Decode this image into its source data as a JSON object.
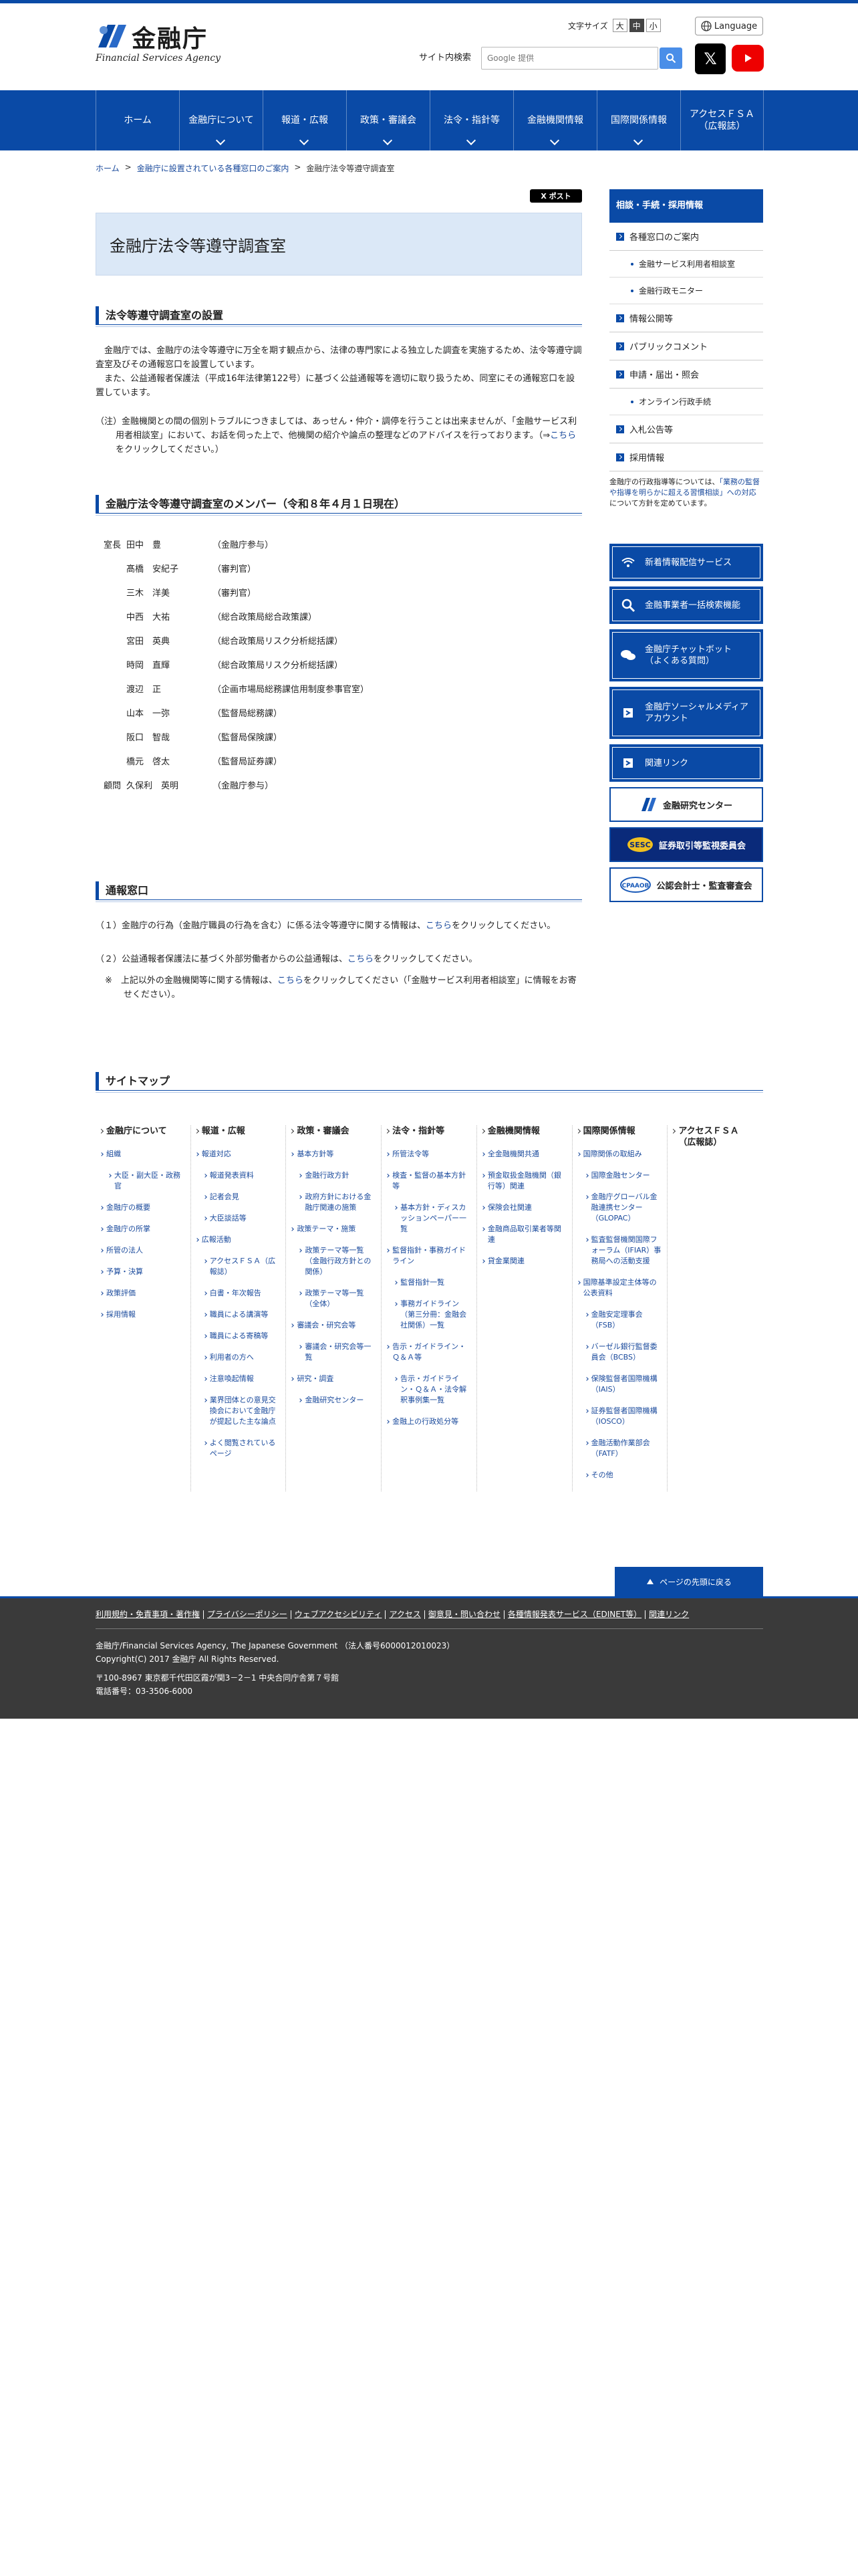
{
  "header": {
    "logo_ja": "金融庁",
    "logo_en": "Financial Services Agency",
    "fontsize_label": "文字サイズ",
    "fontsizes": [
      "大",
      "中",
      "小"
    ],
    "language_label": "Language",
    "search_label": "サイト内検索",
    "search_placeholder": "Google 提供"
  },
  "gnav": [
    {
      "label": "ホーム"
    },
    {
      "label": "金融庁について"
    },
    {
      "label": "報道・広報"
    },
    {
      "label": "政策・審議会"
    },
    {
      "label": "法令・指針等"
    },
    {
      "label": "金融機関情報"
    },
    {
      "label": "国際関係情報"
    },
    {
      "label": "アクセスＦＳＡ\n（広報誌）"
    }
  ],
  "breadcrumb": [
    "ホーム",
    ">",
    "金融庁に設置されている各種窓口のご案内",
    ">",
    "金融庁法令等遵守調査室"
  ],
  "tweet_label": "X ポスト",
  "main": {
    "title": "金融庁法令等遵守調査室",
    "sec1_heading": "法令等遵守調査室の設置",
    "sec1_p1": "　金融庁では、金融庁の法令等遵守に万全を期す観点から、法律の専門家による独立した調査を実施するため、法令等遵守調査室及びその通報窓口を設置しています。",
    "sec1_p2": "　また、公益通報者保護法（平成16年法律第122号）に基づく公益通報等を適切に取り扱うため、同室にその通報窓口を設置しています。",
    "sec1_note_a": "（注）金融機関との間の個別トラブルにつきましては、あっせん・仲介・調停を行うことは出来ませんが、「金融サービス利用者相談室」において、お話を伺った上で、他機関の紹介や論点の整理などのアドバイスを行っております。（⇒",
    "sec1_note_link": "こちら",
    "sec1_note_b": "をクリックしてください。）",
    "sec2_heading": "金融庁法令等遵守調査室のメンバー（令和８年４月１日現在）",
    "members": [
      {
        "title": "室長",
        "name": "田中　豊",
        "position": "（金融庁参与）"
      },
      {
        "title": "",
        "name": "髙橋　安紀子",
        "position": "（審判官）"
      },
      {
        "title": "",
        "name": "三木　洋美",
        "position": "（審判官）"
      },
      {
        "title": "",
        "name": "中西　大祐",
        "position": "（総合政策局総合政策課）"
      },
      {
        "title": "",
        "name": "宮田　英典",
        "position": "（総合政策局リスク分析総括課）"
      },
      {
        "title": "",
        "name": "時岡　直輝",
        "position": "（総合政策局リスク分析総括課）"
      },
      {
        "title": "",
        "name": "渡辺　正",
        "position": "（企画市場局総務課信用制度参事官室）"
      },
      {
        "title": "",
        "name": "山本　一弥",
        "position": "（監督局総務課）"
      },
      {
        "title": "",
        "name": "阪口　智哉",
        "position": "（監督局保険課）"
      },
      {
        "title": "",
        "name": "橋元　啓太",
        "position": "（監督局証券課）"
      },
      {
        "title": "顧問",
        "name": "久保利　英明",
        "position": "（金融庁参与）"
      }
    ],
    "sec3_heading": "通報窓口",
    "sec3_l1a": "（１）金融庁の行為（金融庁職員の行為を含む）に係る法令等遵守に関する情報は、",
    "sec3_l1link": "こちら",
    "sec3_l1b": "をクリックしてください。",
    "sec3_l2a": "（２）公益通報者保護法に基づく外部労働者からの公益通報は、",
    "sec3_l2link": "こちら",
    "sec3_l2b": "をクリックしてください。",
    "sec3_l3a": "※　上記以外の金融機関等に関する情報は、",
    "sec3_l3link": "こちら",
    "sec3_l3b": "をクリックしてください（「金融サービス利用者相談室」に情報をお寄せください）。"
  },
  "sidebar": {
    "heading": "相談・手続・採用情報",
    "items": [
      {
        "label": "各種窓口のご案内",
        "sub": false
      },
      {
        "label": "金融サービス利用者相談室",
        "sub": true
      },
      {
        "label": "金融行政モニター",
        "sub": true
      },
      {
        "label": "情報公開等",
        "sub": false
      },
      {
        "label": "パブリックコメント",
        "sub": false
      },
      {
        "label": "申請・届出・照会",
        "sub": false
      },
      {
        "label": "オンライン行政手続",
        "sub": true
      },
      {
        "label": "入札公告等",
        "sub": false
      },
      {
        "label": "採用情報",
        "sub": false
      }
    ],
    "note_a": "金融庁の行政指導等については、",
    "note_link": "「業務の監督や指導を明らかに超える習慣相談」への対応",
    "note_b": "について方針を定めています。",
    "buttons": [
      {
        "label": "新着情報配信サービス",
        "icon": "rss-icon"
      },
      {
        "label": "金融事業者一括検索機能",
        "icon": "search-icon"
      },
      {
        "label": "金融庁チャットボット\n（よくある質問）",
        "icon": "chatbot-icon"
      },
      {
        "label": "金融庁ソーシャルメディア\nアカウント",
        "icon": "social-icon"
      },
      {
        "label": "関連リンク",
        "icon": "arrow-icon"
      }
    ],
    "banners": [
      {
        "label": "金融研究センター"
      },
      {
        "label": "証券取引等監視委員会"
      },
      {
        "label": "公認会計士・監査審査会"
      }
    ]
  },
  "sitemap": {
    "heading": "サイトマップ",
    "columns": [
      {
        "head": "金融庁について",
        "items": [
          [
            "組織",
            0
          ],
          [
            "大臣・副大臣・政務官",
            1
          ],
          [
            "金融庁の概要",
            0
          ],
          [
            "金融庁の所掌",
            0
          ],
          [
            "所管の法人",
            0
          ],
          [
            "予算・決算",
            0
          ],
          [
            "政策評価",
            0
          ],
          [
            "採用情報",
            0
          ]
        ]
      },
      {
        "head": "報道・広報",
        "items": [
          [
            "報道対応",
            0
          ],
          [
            "報道発表資料",
            1
          ],
          [
            "記者会見",
            1
          ],
          [
            "大臣談話等",
            1
          ],
          [
            "広報活動",
            0
          ],
          [
            "アクセスＦＳＡ（広報誌）",
            1
          ],
          [
            "白書・年次報告",
            1
          ],
          [
            "職員による講演等",
            1
          ],
          [
            "職員による寄稿等",
            1
          ],
          [
            "利用者の方へ",
            1
          ],
          [
            "注意喚起情報",
            1
          ],
          [
            "業界団体との意見交換会において金融庁が提起した主な論点",
            1
          ],
          [
            "よく閲覧されているページ",
            1
          ]
        ]
      },
      {
        "head": "政策・審議会",
        "items": [
          [
            "基本方針等",
            0
          ],
          [
            "金融行政方針",
            1
          ],
          [
            "政府方針における金融庁関連の施策",
            1
          ],
          [
            "政策テーマ・施策",
            0
          ],
          [
            "政策テーマ等一覧（金融行政方針との関係）",
            1
          ],
          [
            "政策テーマ等一覧（全体）",
            1
          ],
          [
            "審議会・研究会等",
            0
          ],
          [
            "審議会・研究会等一覧",
            1
          ],
          [
            "研究・調査",
            0
          ],
          [
            "金融研究センター",
            1
          ]
        ]
      },
      {
        "head": "法令・指針等",
        "items": [
          [
            "所管法令等",
            0
          ],
          [
            "検査・監督の基本方針等",
            0
          ],
          [
            "基本方針・ディスカッションペーパー一覧",
            1
          ],
          [
            "監督指針・事務ガイドライン",
            0
          ],
          [
            "監督指針一覧",
            1
          ],
          [
            "事務ガイドライン（第三分冊：金融会社関係）一覧",
            1
          ],
          [
            "告示・ガイドライン・Ｑ＆Ａ等",
            0
          ],
          [
            "告示・ガイドライン・Ｑ＆Ａ・法令解釈事例集一覧",
            1
          ],
          [
            "金融上の行政処分等",
            0
          ]
        ]
      },
      {
        "head": "金融機関情報",
        "items": [
          [
            "全金融機関共通",
            0
          ],
          [
            "預金取扱金融機関（銀行等）関連",
            0
          ],
          [
            "保険会社関連",
            0
          ],
          [
            "金融商品取引業者等関連",
            0
          ],
          [
            "貸金業関連",
            0
          ]
        ]
      },
      {
        "head": "国際関係情報",
        "items": [
          [
            "国際関係の取組み",
            0
          ],
          [
            "国際金融センター",
            1
          ],
          [
            "金融庁グローバル金融連携センター（GLOPAC）",
            1
          ],
          [
            "監査監督機関国際フォーラム（IFIAR）事務局への活動支援",
            1
          ],
          [
            "国際基準設定主体等の公表資料",
            0
          ],
          [
            "金融安定理事会（FSB）",
            1
          ],
          [
            "バーゼル銀行監督委員会（BCBS）",
            1
          ],
          [
            "保険監督者国際機構（IAIS）",
            1
          ],
          [
            "証券監督者国際機構（IOSCO）",
            1
          ],
          [
            "金融活動作業部会（FATF）",
            1
          ],
          [
            "その他",
            1
          ]
        ]
      },
      {
        "head": "アクセスＦＳＡ\n（広報誌）",
        "items": []
      }
    ]
  },
  "pagetop_label": "ページの先頭に戻る",
  "footer": {
    "links": [
      "利用規約・免責事項・著作権",
      "プライバシーポリシー",
      "ウェブアクセシビリティ",
      "アクセス",
      "御意見・問い合わせ",
      "各種情報発表サービス（EDINET等）",
      "関連リンク"
    ],
    "org": "金融庁/Financial Services Agency, The Japanese Government （法人番号6000012010023）",
    "copyright": "Copyright(C) 2017 金融庁 All Rights Reserved.",
    "address": "〒100-8967 東京都千代田区霞が関3－2－1 中央合同庁舎第７号館",
    "phone": "電話番号：03-3506-6000"
  }
}
